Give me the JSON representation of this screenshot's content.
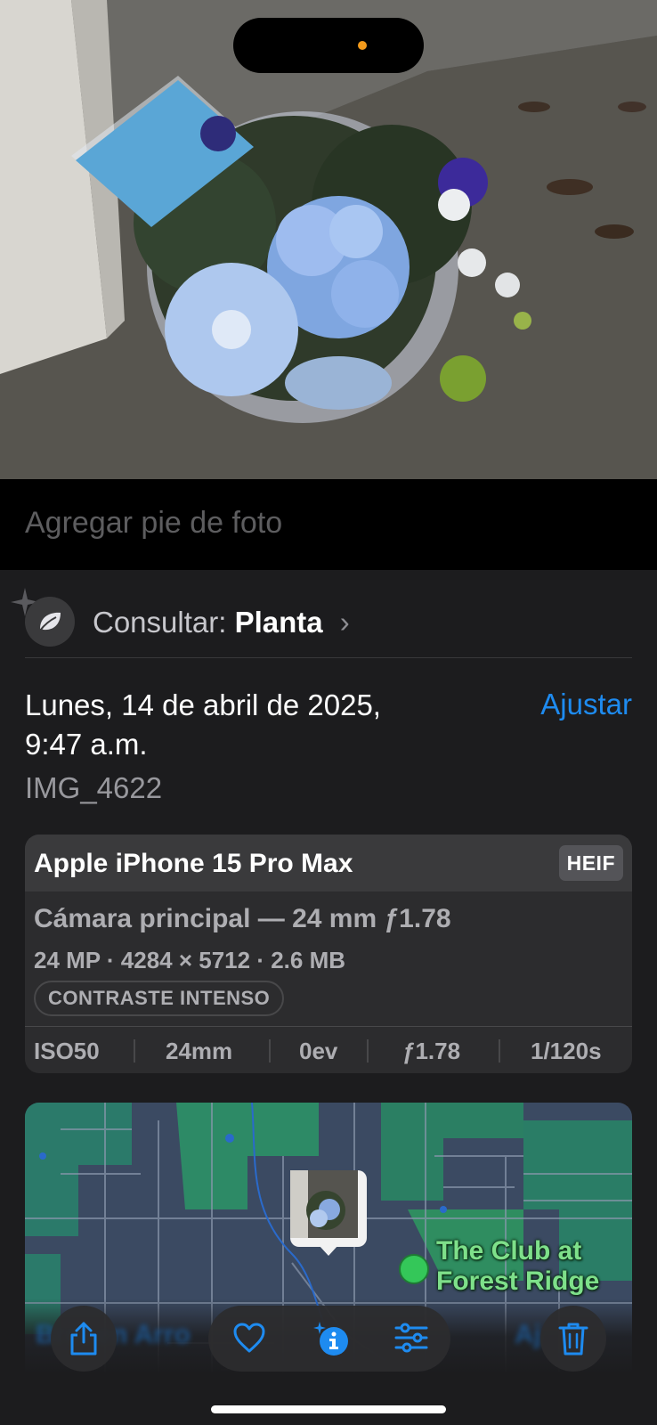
{
  "photo": {
    "subject": "flower-bouquet",
    "visual_lookup_highlight": true
  },
  "caption": {
    "placeholder": "Agregar pie de foto"
  },
  "lookup": {
    "prefix": "Consultar:",
    "subject": "Planta",
    "chevron": "›"
  },
  "datetime": {
    "line1": "Lunes, 14 de abril de 2025,",
    "line2": "9:47 a.m.",
    "adjust_label": "Ajustar"
  },
  "filename": "IMG_4622",
  "camera": {
    "device": "Apple iPhone 15 Pro Max",
    "format": "HEIF",
    "lens": "Cámara principal — 24 mm ƒ1.78",
    "specs": "24 MP · 4284 × 5712 · 2.6 MB",
    "photographic_style": "CONTRASTE INTENSO",
    "exif": [
      "ISO50",
      "24mm",
      "0ev",
      "ƒ1.78",
      "1/120s"
    ]
  },
  "map": {
    "poi_name_line1": "The Club at",
    "poi_name_line2": "Forest Ridge"
  },
  "toolbar": {
    "ghost_left": "Broken Arro",
    "ghost_right": "Aj",
    "buttons": [
      "share-icon",
      "heart-icon",
      "info-icon",
      "adjust-icon",
      "trash-icon"
    ],
    "accent": "#1e8bf0"
  },
  "colors": {
    "accent": "#1e8bf0",
    "panel": "#1c1c1e",
    "card": "#2c2c2e"
  }
}
